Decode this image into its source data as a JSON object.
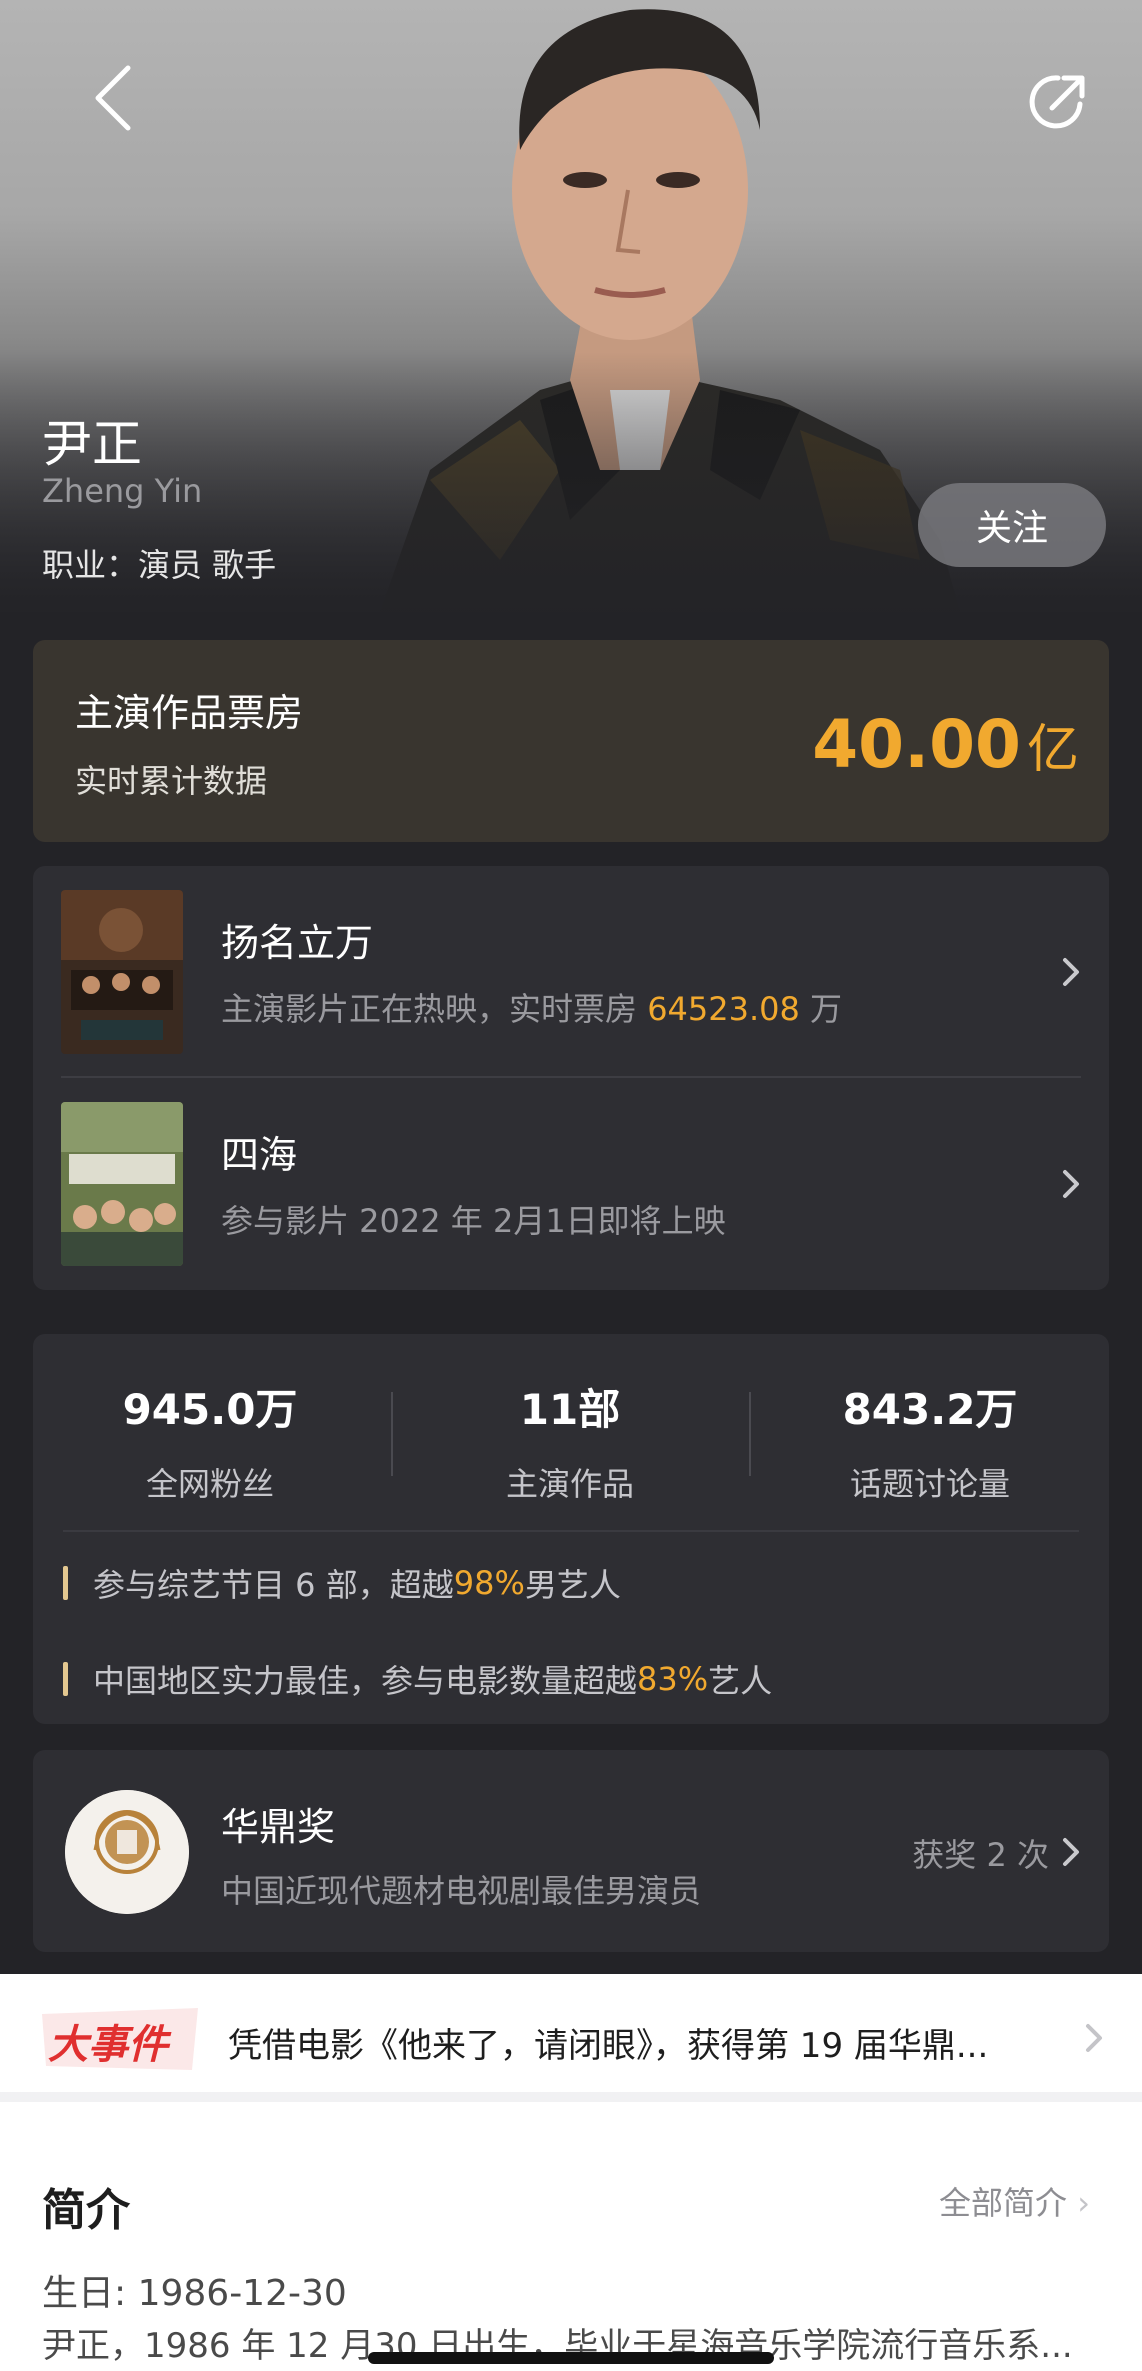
{
  "header": {
    "name_cn": "尹正",
    "name_en": "Zheng Yin",
    "profession": "职业：演员 歌手",
    "follow_label": "关注"
  },
  "boxoffice": {
    "title": "主演作品票房",
    "subtitle": "实时累计数据",
    "value": "40.00",
    "unit": "亿"
  },
  "movies": [
    {
      "title": "扬名立万",
      "desc_prefix": "主演影片正在热映，实时票房 ",
      "desc_highlight": "64523.08",
      "desc_suffix": " 万"
    },
    {
      "title": "四海",
      "desc_prefix": "参与影片 2022 年 2月1日即将上映",
      "desc_highlight": "",
      "desc_suffix": ""
    }
  ],
  "stats": [
    {
      "value": "945.0万",
      "label": "全网粉丝"
    },
    {
      "value": "11部",
      "label": "主演作品"
    },
    {
      "value": "843.2万",
      "label": "话题讨论量"
    }
  ],
  "facts": [
    {
      "prefix": "参与综艺节目 6 部，超越 ",
      "highlight": "98%",
      "suffix": " 男艺人"
    },
    {
      "prefix": "中国地区实力最佳，参与电影数量超越 ",
      "highlight": "83%",
      "suffix": " 艺人"
    }
  ],
  "award": {
    "name": "华鼎奖",
    "desc": "中国近现代题材电视剧最佳男演员",
    "count": "获奖 2 次",
    "logo_text": "华鼎奖"
  },
  "events": {
    "badge": "大事件",
    "text": "凭借电影《他来了，请闭眼》，获得第 19 届华鼎..."
  },
  "intro": {
    "title": "简介",
    "all_label": "全部简介",
    "birthday": "生日: 1986-12-30",
    "body": "尹正，1986 年 12 月30 日出生，毕业于星海音乐学院流行音乐系..."
  },
  "colors": {
    "accent_gold": "#f1a92f",
    "background": "#232327",
    "card": "#2e2e33"
  }
}
